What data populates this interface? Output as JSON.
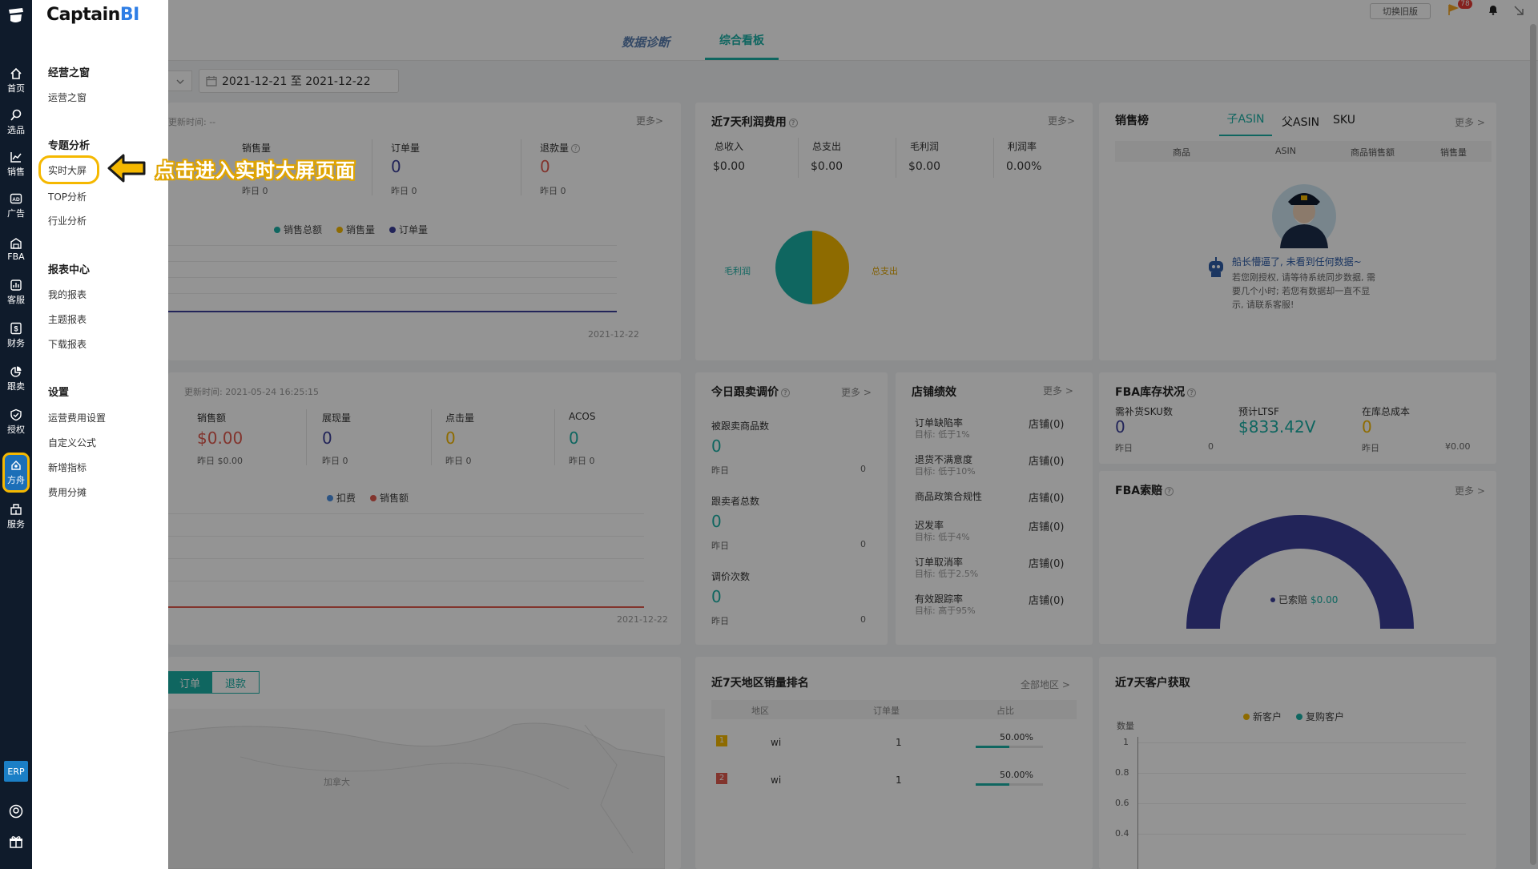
{
  "app": {
    "logo_main": "Captain",
    "logo_accent": "BI"
  },
  "rail": [
    {
      "label": "首页",
      "icon": "home-icon"
    },
    {
      "label": "选品",
      "icon": "search-icon"
    },
    {
      "label": "销售",
      "icon": "sales-chart-icon"
    },
    {
      "label": "广告",
      "icon": "ad-icon"
    },
    {
      "label": "FBA",
      "icon": "warehouse-icon"
    },
    {
      "label": "客服",
      "icon": "service-icon"
    },
    {
      "label": "财务",
      "icon": "finance-icon"
    },
    {
      "label": "跟卖",
      "icon": "pie-icon"
    },
    {
      "label": "授权",
      "icon": "shield-icon"
    },
    {
      "label": "方舟",
      "icon": "ark-icon"
    },
    {
      "label": "服务",
      "icon": "building-icon"
    }
  ],
  "rail_erp": "ERP",
  "menu": {
    "sections": [
      {
        "title": "经营之窗",
        "items": [
          "运营之窗"
        ]
      },
      {
        "title": "专题分析",
        "items": [
          "实时大屏",
          "TOP分析",
          "行业分析"
        ]
      },
      {
        "title": "报表中心",
        "items": [
          "我的报表",
          "主题报表",
          "下载报表"
        ]
      },
      {
        "title": "设置",
        "items": [
          "运营费用设置",
          "自定义公式",
          "新增指标",
          "费用分摊"
        ]
      }
    ]
  },
  "callout": "点击进入实时大屏页面",
  "topbar": {
    "switch_label": "切换旧版",
    "badge": "78"
  },
  "tabs": {
    "diagnose": "数据诊断",
    "dashboard": "综合看板"
  },
  "date_range": "2021-12-21 至 2021-12-22",
  "sales_card": {
    "update": "更新时间: --",
    "more": "更多>",
    "m1_label": "销售量",
    "m1_yest": "昨日  0",
    "m2_label": "订单量",
    "m2_value": "0",
    "m2_yest": "昨日  0",
    "m3_label": "退款量",
    "m3_value": "0",
    "m3_yest": "昨日  0",
    "legend": [
      "销售总额",
      "销售量",
      "订单量"
    ],
    "date_label": "2021-12-22"
  },
  "profit_card": {
    "title": "近7天利润费用",
    "more": "更多>",
    "metrics": [
      {
        "label": "总收入",
        "value": "$0.00"
      },
      {
        "label": "总支出",
        "value": "$0.00"
      },
      {
        "label": "毛利润",
        "value": "$0.00"
      },
      {
        "label": "利润率",
        "value": "0.00%"
      }
    ],
    "pie_left": "毛利润",
    "pie_right": "总支出"
  },
  "rank_card": {
    "title": "销售榜",
    "more": "更多 >",
    "tabs": [
      "子ASIN",
      "父ASIN",
      "SKU"
    ],
    "cols": [
      "商品",
      "ASIN",
      "商品销售额",
      "销售量"
    ],
    "empty_title": "船长懵逼了, 未看到任何数据~",
    "empty_body_1": "若您刚授权, 请等待系统同步数据, 需",
    "empty_body_2": "要几个小时; 若您有数据却一直不显",
    "empty_body_3": "示, 请联系客服!"
  },
  "ad_card": {
    "update": "更新时间: 2021-05-24 16:25:15",
    "metrics": [
      {
        "label": "销售额",
        "value": "$0.00",
        "yest": "昨日   $0.00"
      },
      {
        "label": "展现量",
        "value": "0",
        "yest": "昨日   0"
      },
      {
        "label": "点击量",
        "value": "0",
        "yest": "昨日   0"
      },
      {
        "label": "ACOS",
        "value": "0",
        "yest": "昨日   0"
      }
    ],
    "legend": [
      "扣费",
      "销售额"
    ],
    "date_label": "2021-12-22"
  },
  "follow_card": {
    "title": "今日跟卖调价",
    "more": "更多 >",
    "rows": [
      {
        "label": "被跟卖商品数",
        "value": "0",
        "yest": "昨日",
        "yest_val": "0"
      },
      {
        "label": "跟卖者总数",
        "value": "0",
        "yest": "昨日",
        "yest_val": "0"
      },
      {
        "label": "调价次数",
        "value": "0",
        "yest": "昨日",
        "yest_val": "0"
      }
    ]
  },
  "store_card": {
    "title": "店铺绩效",
    "more": "更多 >",
    "rows": [
      {
        "label": "订单缺陷率",
        "target": "目标: 低于1%",
        "value": "店铺(0)"
      },
      {
        "label": "退货不满意度",
        "target": "目标: 低于10%",
        "value": "店铺(0)"
      },
      {
        "label": "商品政策合规性",
        "target": "",
        "value": "店铺(0)"
      },
      {
        "label": "迟发率",
        "target": "目标: 低于4%",
        "value": "店铺(0)"
      },
      {
        "label": "订单取消率",
        "target": "目标: 低于2.5%",
        "value": "店铺(0)"
      },
      {
        "label": "有效跟踪率",
        "target": "目标: 高于95%",
        "value": "店铺(0)"
      }
    ]
  },
  "fba_stock": {
    "title": "FBA库存状况",
    "m1_label": "需补货SKU数",
    "m1_value": "0",
    "m1_yest": "昨日",
    "m1_yest_val": "0",
    "m2_label": "预计LTSF",
    "m2_value": "$833.42V",
    "m3_label": "在库总成本",
    "m3_value": "0",
    "m3_yest": "昨日",
    "m3_yest_val": "¥0.00"
  },
  "fba_claim": {
    "title": "FBA索赔",
    "more": "更多 >",
    "legend_label": "已索赔",
    "legend_value": "$0.00"
  },
  "map_card": {
    "tab_order": "订单",
    "tab_refund": "退款",
    "region": "加拿大"
  },
  "region_card": {
    "title": "近7天地区销量排名",
    "more": "全部地区 >",
    "cols": [
      "地区",
      "订单量",
      "占比"
    ],
    "rows": [
      {
        "rank": "1",
        "region": "wi",
        "orders": "1",
        "pct": "50.00%",
        "pct_num": 0.5
      },
      {
        "rank": "2",
        "region": "wi",
        "orders": "1",
        "pct": "50.00%",
        "pct_num": 0.5
      }
    ]
  },
  "cust_card": {
    "title": "近7天客户获取",
    "legend": [
      "新客户",
      "复购客户"
    ],
    "ylabel": "数量",
    "ticks": [
      "1",
      "0.8",
      "0.6",
      "0.4"
    ]
  },
  "colors": {
    "teal": "#1ab0a5",
    "gold": "#f5b800",
    "navy": "#3b3f9a",
    "red": "#e05a4f",
    "blue": "#4a90e2"
  }
}
